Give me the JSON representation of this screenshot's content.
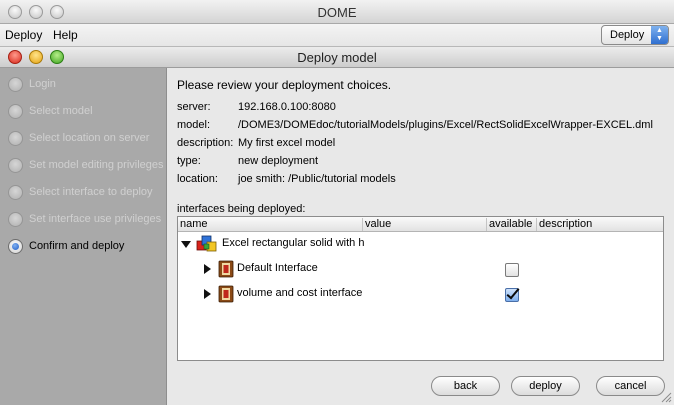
{
  "app": {
    "title": "DOME"
  },
  "menu": {
    "items": [
      "Deploy",
      "Help"
    ],
    "mode_select": "Deploy"
  },
  "dialog": {
    "title": "Deploy model",
    "steps": [
      {
        "label": "Login",
        "active": false
      },
      {
        "label": "Select model",
        "active": false
      },
      {
        "label": "Select location on server",
        "active": false
      },
      {
        "label": "Set model editing privileges",
        "active": false
      },
      {
        "label": "Select interface to deploy",
        "active": false
      },
      {
        "label": "Set interface use privileges",
        "active": false
      },
      {
        "label": "Confirm and deploy",
        "active": true
      }
    ],
    "heading": "Please review your deployment choices.",
    "details": [
      {
        "key": "server:",
        "value": "192.168.0.100:8080"
      },
      {
        "key": "model:",
        "value": "/DOME3/DOMEdoc/tutorialModels/plugins/Excel/RectSolidExcelWrapper-EXCEL.dml"
      },
      {
        "key": "description:",
        "value": "My first excel model"
      },
      {
        "key": "type:",
        "value": "new deployment"
      },
      {
        "key": "location:",
        "value": "joe smith: /Public/tutorial models"
      }
    ],
    "interfaces_label": "interfaces being deployed:",
    "table": {
      "columns": [
        "name",
        "value",
        "available",
        "description"
      ],
      "model_row": {
        "name": "Excel rectangular solid with h",
        "icon": "model-cube-icon"
      },
      "interfaces": [
        {
          "name": "Default Interface",
          "available": false,
          "icon": "interface-icon"
        },
        {
          "name": "volume and cost interface",
          "available": true,
          "icon": "interface-icon"
        }
      ]
    },
    "buttons": {
      "back": "back",
      "deploy": "deploy",
      "cancel": "cancel"
    }
  },
  "colors": {
    "accent": "#2f6fd0",
    "sidebar": "#a9a9a9",
    "disabled_text": "#d0d0d0"
  }
}
